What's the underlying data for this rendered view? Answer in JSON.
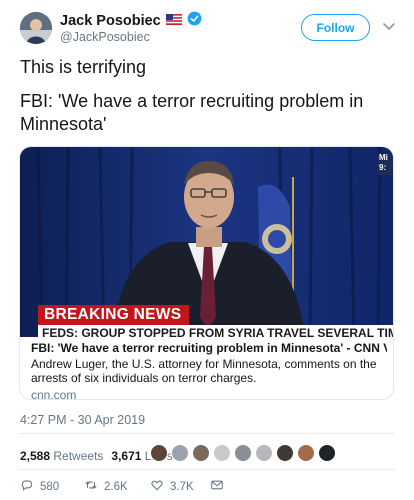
{
  "author": {
    "name": "Jack Posobiec",
    "flag_emoji": "🇺🇸",
    "verified": true,
    "handle": "@JackPosobiec"
  },
  "follow_button": {
    "label": "Follow"
  },
  "tweet": {
    "paragraphs": [
      "This is terrifying",
      "FBI: 'We have a terror recruiting problem in Minnesota'"
    ]
  },
  "card": {
    "video_banner": "BREAKING NEWS",
    "video_ticker": "FEDS: GROUP STOPPED FROM SYRIA TRAVEL SEVERAL TIMES",
    "video_bug": "Mi 9:",
    "title": "FBI: 'We have a terror recruiting problem in Minnesota' - CNN Video",
    "description": "Andrew Luger, the U.S. attorney for Minnesota, comments on the arrests of six individuals on terror charges.",
    "domain": "cnn.com"
  },
  "timestamp": "4:27 PM - 30 Apr 2019",
  "stats": {
    "retweets_count": "2,588",
    "retweets_label": "Retweets",
    "likes_count": "3,671",
    "likes_label": "Likes"
  },
  "likers": [
    {
      "color": "#5b4636"
    },
    {
      "color": "#9aa3ab"
    },
    {
      "color": "#7a6a5e"
    },
    {
      "color": "#c9c9c9"
    },
    {
      "color": "#8a8f96"
    },
    {
      "color": "#b5b7ba"
    },
    {
      "color": "#3f3a36"
    },
    {
      "color": "#a06c4a"
    },
    {
      "color": "#1f2327"
    }
  ],
  "actions": {
    "replies": "580",
    "retweets": "2.6K",
    "likes": "3.7K"
  },
  "colors": {
    "accent": "#1da1f2",
    "banner_red": "#c4151c",
    "muted": "#657786"
  }
}
